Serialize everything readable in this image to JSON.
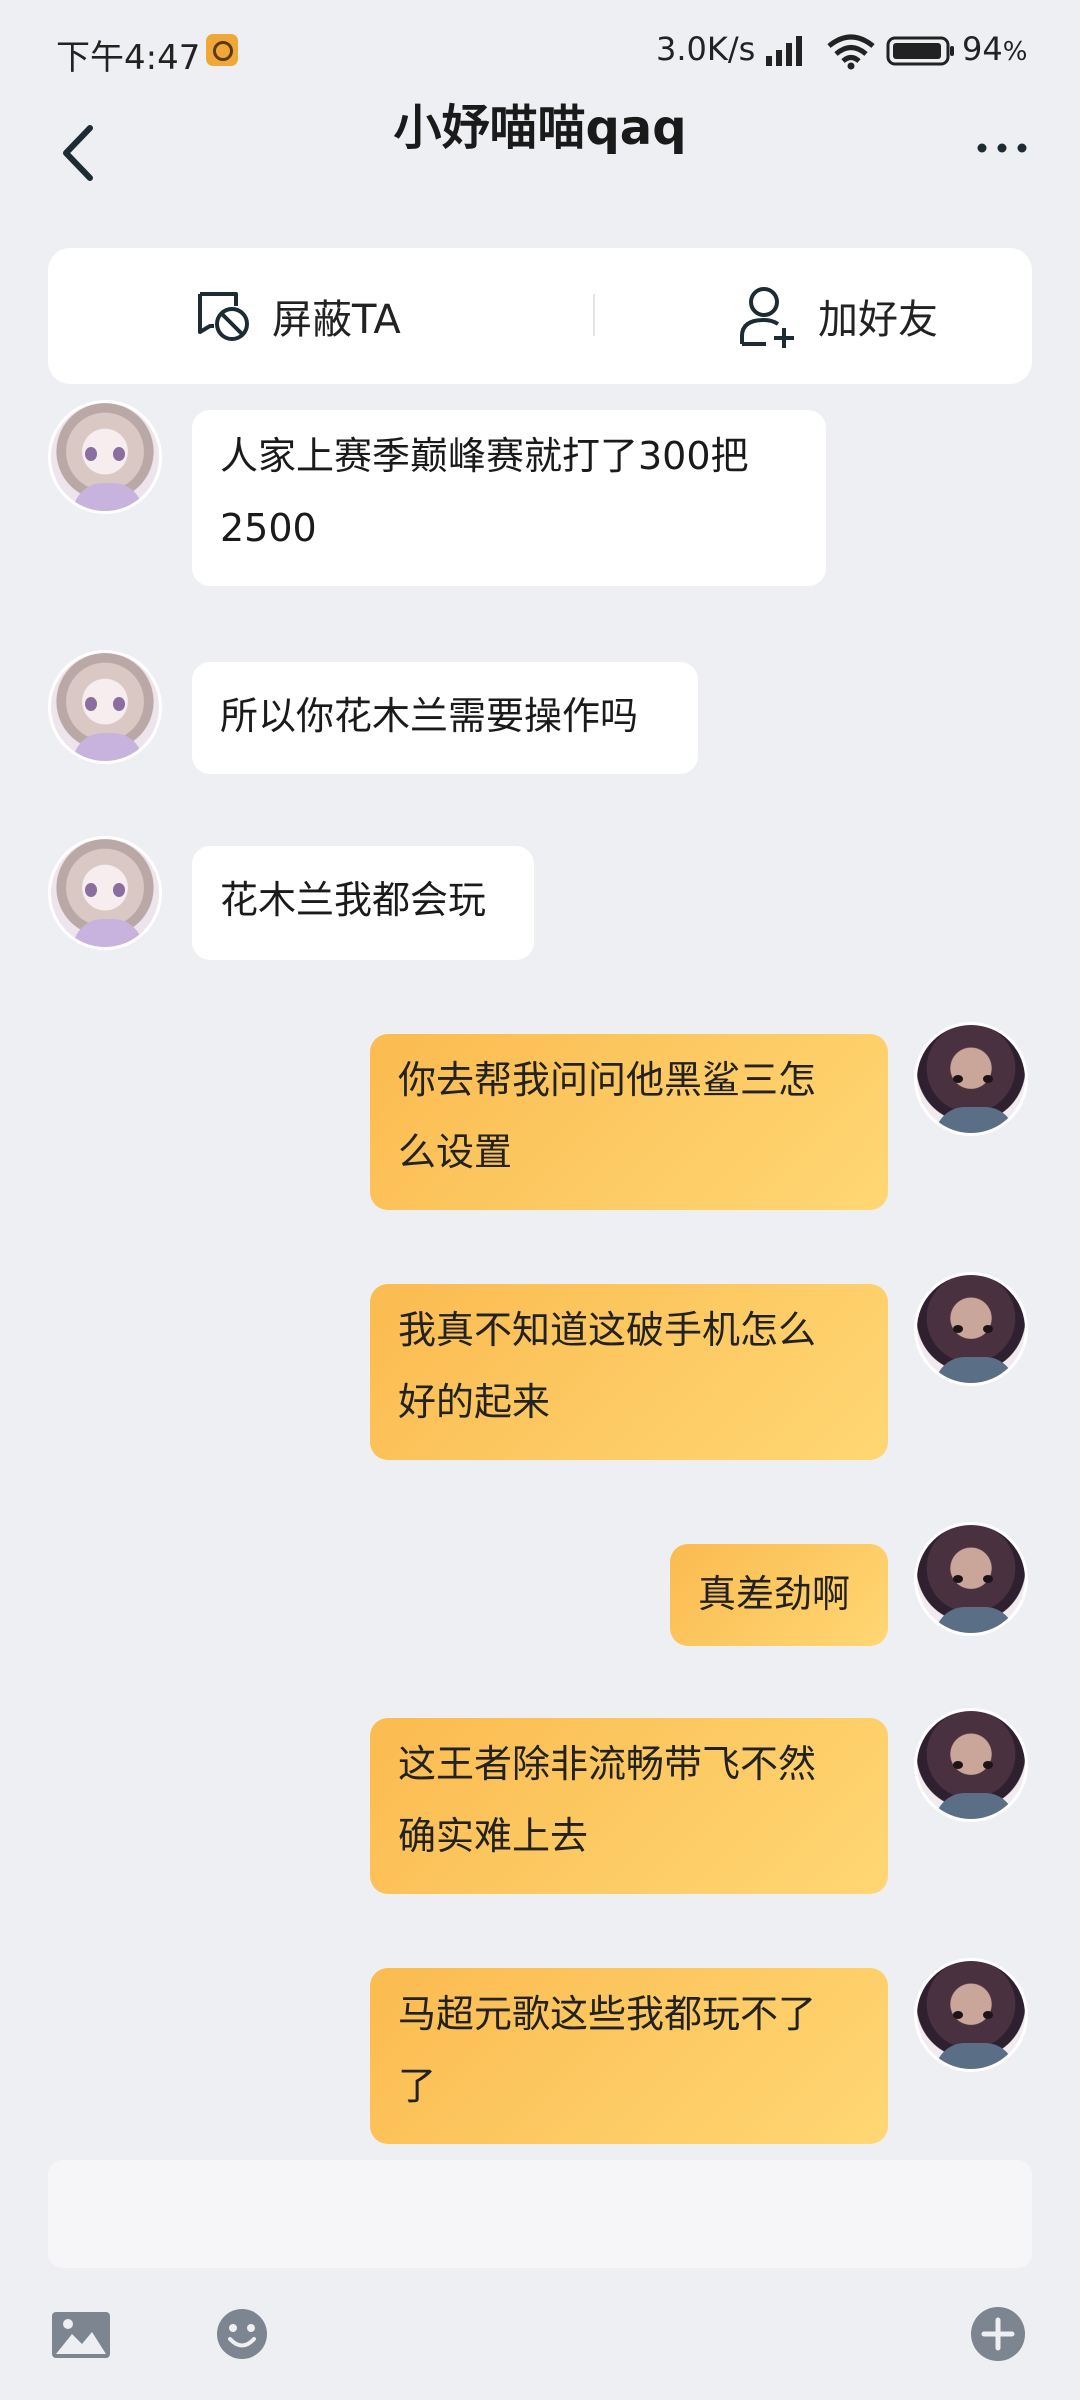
{
  "status_bar": {
    "time": "下午4:47",
    "net_speed": "3.0K/s",
    "battery": "94",
    "battery_unit": "%"
  },
  "header": {
    "title": "小妤喵喵qaq"
  },
  "actions": {
    "block_label": "屏蔽TA",
    "add_friend_label": "加好友"
  },
  "messages": [
    {
      "side": "left",
      "lines": [
        "人家上赛季巅峰赛就打了300把",
        "2500"
      ]
    },
    {
      "side": "left",
      "lines": [
        "所以你花木兰需要操作吗"
      ]
    },
    {
      "side": "left",
      "lines": [
        "花木兰我都会玩"
      ]
    },
    {
      "side": "right",
      "lines": [
        "你去帮我问问他黑鲨三怎",
        "么设置"
      ]
    },
    {
      "side": "right",
      "lines": [
        "我真不知道这破手机怎么",
        "好的起来"
      ]
    },
    {
      "side": "right",
      "lines": [
        "真差劲啊"
      ]
    },
    {
      "side": "right",
      "lines": [
        "这王者除非流畅带飞不然",
        "确实难上去"
      ]
    },
    {
      "side": "right",
      "lines": [
        "马超元歌这些我都玩不了",
        "了"
      ]
    }
  ],
  "input": {
    "placeholder": ""
  },
  "colors": {
    "background": "#eeeff3",
    "bubble_mine": "#fdc865",
    "bubble_theirs": "#ffffff"
  }
}
